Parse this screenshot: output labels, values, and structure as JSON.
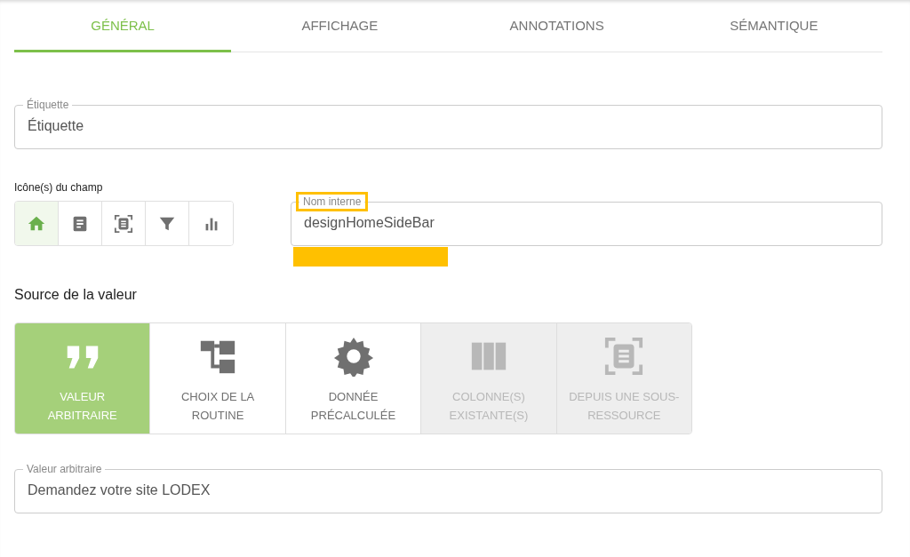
{
  "tabs": [
    {
      "label": "GÉNÉRAL",
      "selected": true
    },
    {
      "label": "AFFICHAGE",
      "selected": false
    },
    {
      "label": "ANNOTATIONS",
      "selected": false
    },
    {
      "label": "SÉMANTIQUE",
      "selected": false
    }
  ],
  "label_field": {
    "legend": "Étiquette",
    "value": "Étiquette"
  },
  "icons_picker": {
    "label": "Icône(s) du champ",
    "icons": [
      {
        "selected": true
      },
      {
        "selected": false
      },
      {
        "selected": false
      },
      {
        "selected": false
      },
      {
        "selected": false
      }
    ]
  },
  "internal_name": {
    "legend": "Nom interne",
    "value": "designHomeSideBar",
    "highlighted": true
  },
  "value_source": {
    "title": "Source de la valeur",
    "options": [
      {
        "label": "VALEUR ARBITRAIRE",
        "selected": true,
        "disabled": false
      },
      {
        "label": "CHOIX DE LA ROUTINE",
        "selected": false,
        "disabled": false
      },
      {
        "label": "DONNÉE PRÉCALCULÉE",
        "selected": false,
        "disabled": false
      },
      {
        "label": "COLONNE(S) EXISTANTE(S)",
        "selected": false,
        "disabled": true
      },
      {
        "label": "DEPUIS UNE SOUS-RESSOURCE",
        "selected": false,
        "disabled": true
      }
    ]
  },
  "arbitrary_value": {
    "legend": "Valeur arbitraire",
    "value": "Demandez votre site LODEX"
  }
}
